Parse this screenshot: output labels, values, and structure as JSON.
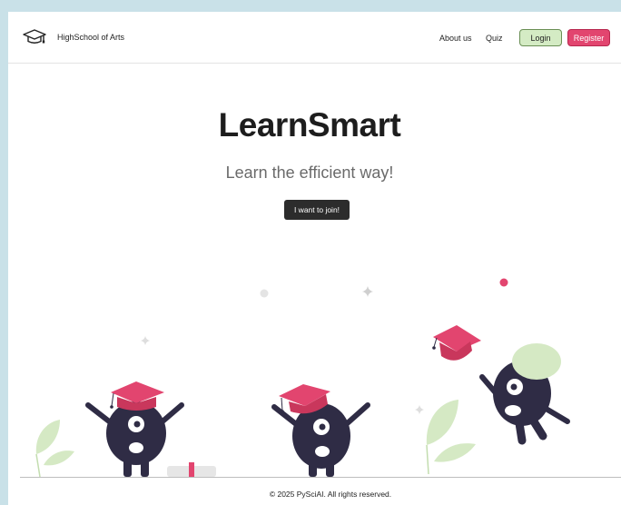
{
  "navbar": {
    "logo_icon": "graduation-cap-icon",
    "brand": "HighSchool of Arts",
    "links": [
      "About us",
      "Quiz"
    ],
    "login_label": "Login",
    "register_label": "Register"
  },
  "hero": {
    "title": "LearnSmart",
    "subtitle": "Learn the efficient way!",
    "cta_label": "I want to join!"
  },
  "footer": {
    "text": "© 2025 PySciAI. All rights reserved."
  },
  "colors": {
    "background": "#c9e1e8",
    "accent_pink": "#e2456f",
    "accent_green": "#d4ebc4",
    "monster": "#2f2c45",
    "dark_button": "#2c2c2c"
  }
}
